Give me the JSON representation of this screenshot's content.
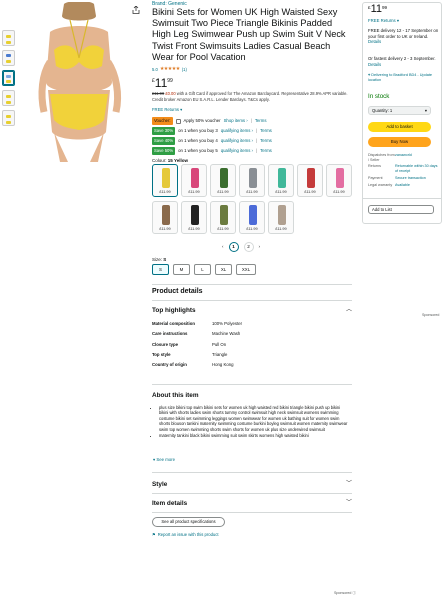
{
  "product": {
    "brand": "Brand: Genenic",
    "title": "Bikini Sets for Women UK High Waisted Sexy Swimsuit Two Piece Triangle Bikinis Padded High Leg Swimwear Push up Swim Suit V Neck Twist Front Swimsuits Ladies Casual Beach Wear for Pool Vacation",
    "rating_value": "5.0",
    "stars": "★★★★★",
    "rating_count": "(1)",
    "price_currency": "£",
    "price_whole": "11",
    "price_fraction": "99",
    "promo_old_price": "£11.99",
    "promo_new_price": "£0.00",
    "promo_text": "with a Gift Card if approved for The Amazon Barclaycard. Representative 28.9% APR variable. Credit broker Amazon EU S.A.R.L. Lender Barclays. T&Cs apply.",
    "free_returns": "FREE Returns ▾"
  },
  "coupons": [
    {
      "badge": "Voucher:",
      "text": "Apply 50% voucher",
      "link1": "Shop items ›",
      "sep": "|",
      "link2": "Terms"
    },
    {
      "badge": "Save 30%",
      "text": "on 1 when you buy 3",
      "link1": "qualifying items ›",
      "sep": "|",
      "link2": "Terms"
    },
    {
      "badge": "Save 40%",
      "text": "on 1 when you buy 4",
      "link1": "qualifying items ›",
      "sep": "|",
      "link2": "Terms"
    },
    {
      "badge": "Save 50%",
      "text": "on 1 when you buy 5",
      "link1": "qualifying items ›",
      "sep": "|",
      "link2": "Terms"
    }
  ],
  "colour": {
    "label": "Colour:",
    "selected": "15 Yellow",
    "swatches": [
      {
        "price": "£11.99",
        "color": "#e5c93a",
        "selected": true
      },
      {
        "price": "£11.99",
        "color": "#d8477a"
      },
      {
        "price": "£11.99",
        "color": "#3b6e2f"
      },
      {
        "price": "£11.99",
        "color": "#8a8f95"
      },
      {
        "price": "£11.99",
        "color": "#41b89a"
      },
      {
        "price": "£11.99",
        "color": "#c43a3a"
      },
      {
        "price": "£11.99",
        "color": "#e36da1"
      },
      {
        "price": "£11.99",
        "color": "#8a6a4c"
      },
      {
        "price": "£11.99",
        "color": "#222222"
      },
      {
        "price": "£11.99",
        "color": "#6b7b3f"
      },
      {
        "price": "£11.99",
        "color": "#4c6bd8"
      },
      {
        "price": "£11.99",
        "color": "#b0a090"
      }
    ]
  },
  "pager": {
    "prev": "‹",
    "pages": [
      "1",
      "2"
    ],
    "next": "›"
  },
  "size": {
    "label": "Size:",
    "selected": "S",
    "options": [
      "S",
      "M",
      "L",
      "XL",
      "XXL"
    ]
  },
  "details": {
    "heading": "Product details",
    "top_highlights": "Top highlights",
    "sponsored": "Sponsored",
    "specs": [
      {
        "k": "Material composition",
        "v": "100% Polyester"
      },
      {
        "k": "Care instructions",
        "v": "Machine Wash"
      },
      {
        "k": "Closure type",
        "v": "Pull On"
      },
      {
        "k": "Top style",
        "v": "Triangle"
      },
      {
        "k": "Country of origin",
        "v": "Hong Kong"
      }
    ],
    "about_title": "About this item",
    "about_bullets": [
      "plus size bikini top swim bikini sets for women uk high waisted red bikini triangle bikini push up bikini bikini with shorts ladies swim shorts tummy control swimsuit high neck swimsuit womens swimming costume bikini set swimming leggings women swimwear for women uk bathing suit for women swim shorts blouson tankini maternity swimming costume burkini boyleg swimsuit women maternity swimwear swim top women swimming shorts swim shorts for women uk plus size underwired swimsuit",
      "maternity tankini black bikini swimming suit swim skirts womens high waisted bikini"
    ],
    "see_more": "See more",
    "style": "Style",
    "item_details": "Item details",
    "see_all_specs": "See all product specifications",
    "report": "Report an issue with this product"
  },
  "buybox": {
    "price_currency": "£",
    "price_whole": "11",
    "price_fraction": "99",
    "free_returns": "FREE Returns ▾",
    "delivery": "FREE delivery 12 - 17 September on your first order to UK or Ireland.",
    "details_link": "Details",
    "fastest": "Or fastest delivery 2 - 3 September.",
    "location": "Delivering to Bradford BD4 - Update location",
    "in_stock": "In stock",
    "quantity": "Quantity: 1",
    "add_to_basket": "Add to basket",
    "buy_now": "Buy Now",
    "info": [
      {
        "k": "Dispatches from / Seller",
        "v": "zanaworld"
      },
      {
        "k": "Returns",
        "v": "Returnable within 30 days of receipt"
      },
      {
        "k": "Payment",
        "v": "Secure transaction"
      },
      {
        "k": "Legal warranty",
        "v": "Available"
      }
    ],
    "add_to_list": "Add to List"
  },
  "footer": {
    "sponsored": "Sponsored ⓘ"
  }
}
